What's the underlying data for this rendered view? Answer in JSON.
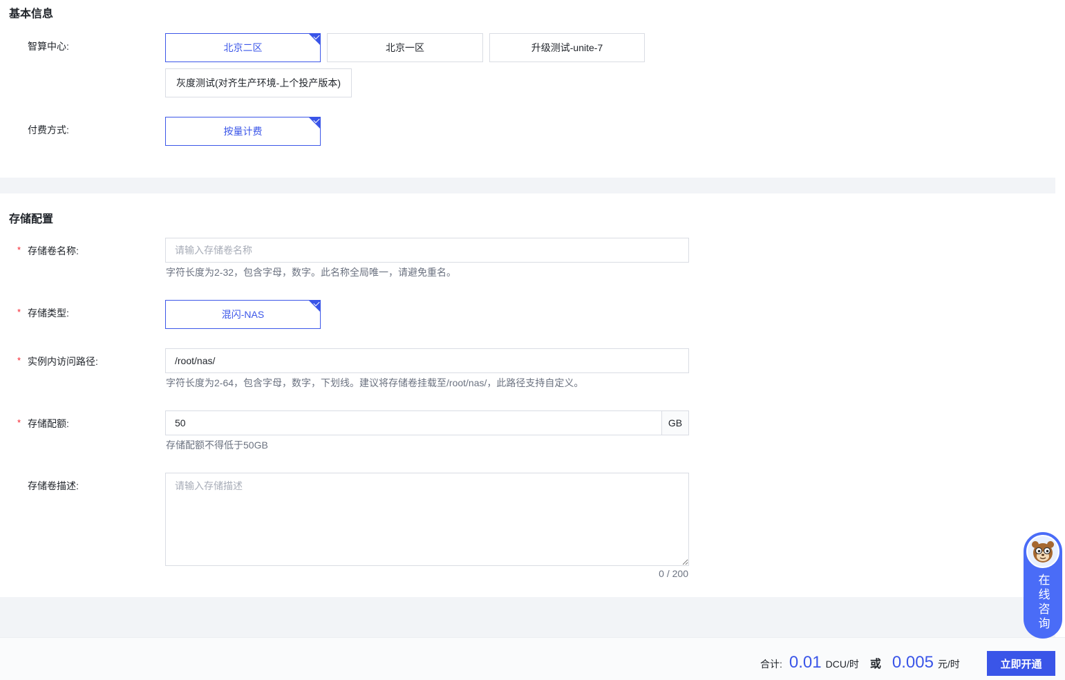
{
  "basic": {
    "title": "基本信息",
    "center_label": "智算中心:",
    "centers": [
      "北京二区",
      "北京一区",
      "升级测试-unite-7",
      "灰度测试(对齐生产环境-上个投产版本)"
    ],
    "selected_center": 0,
    "billing_label": "付费方式:",
    "billing_option": "按量计费"
  },
  "storage": {
    "title": "存储配置",
    "required_mark": "*",
    "name_label": "存储卷名称:",
    "name_placeholder": "请输入存储卷名称",
    "name_hint": "字符长度为2-32，包含字母，数字。此名称全局唯一，请避免重名。",
    "type_label": "存储类型:",
    "type_option": "混闪-NAS",
    "path_label": "实例内访问路径:",
    "path_value": "/root/nas/",
    "path_hint": "字符长度为2-64，包含字母，数字，下划线。建议将存储卷挂载至/root/nas/，此路径支持自定义。",
    "quota_label": "存储配额:",
    "quota_value": "50",
    "quota_unit": "GB",
    "quota_hint": "存储配额不得低于50GB",
    "desc_label": "存储卷描述:",
    "desc_placeholder": "请输入存储描述",
    "desc_counter": "0 / 200"
  },
  "footer": {
    "total_label": "合计:",
    "dcu_price": "0.01",
    "dcu_unit": "DCU/时",
    "or_text": "或",
    "cny_price": "0.005",
    "cny_unit": "元/时",
    "submit_label": "立即开通"
  },
  "consult": {
    "label": "在线咨询",
    "icon": "mascot-avatar-icon"
  },
  "colors": {
    "accent": "#3a55e8",
    "required": "#f5222d",
    "consult_bg": "#4a6cf7"
  }
}
